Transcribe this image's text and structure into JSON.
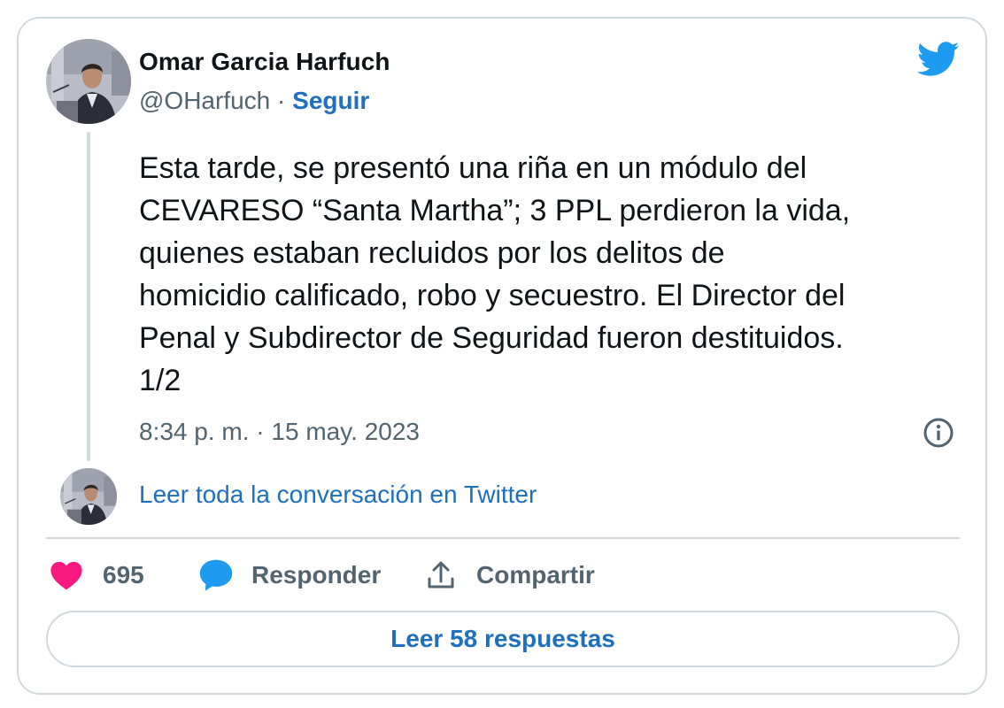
{
  "author": {
    "name": "Omar Garcia Harfuch",
    "handle": "@OHarfuch",
    "separator": " · ",
    "follow_label": "Seguir"
  },
  "tweet": {
    "text": "Esta tarde, se presentó una riña en un módulo del\nCEVARESO “Santa Martha”; 3 PPL perdieron la vida,\nquienes estaban recluidos por los delitos de\nhomicidio calificado, robo y secuestro. El Director del\nPenal y Subdirector de Seguridad fueron destituidos.\n1/2",
    "timestamp": "8:34 p. m. · 15 may. 2023"
  },
  "conversation_link": "Leer toda la conversación en Twitter",
  "actions": {
    "like_count": "695",
    "reply_label": "Responder",
    "share_label": "Compartir"
  },
  "read_replies_label": "Leer 58 respuestas",
  "icons": {
    "brand": "twitter-bird-icon",
    "info": "info-icon",
    "like": "heart-icon",
    "reply": "speech-bubble-icon",
    "share": "share-upload-icon"
  },
  "colors": {
    "twitter_blue": "#1d9bf0",
    "link_blue": "#1d6fbf",
    "like_pink": "#f91880",
    "secondary_text": "#536471",
    "border": "#cfd9de"
  }
}
